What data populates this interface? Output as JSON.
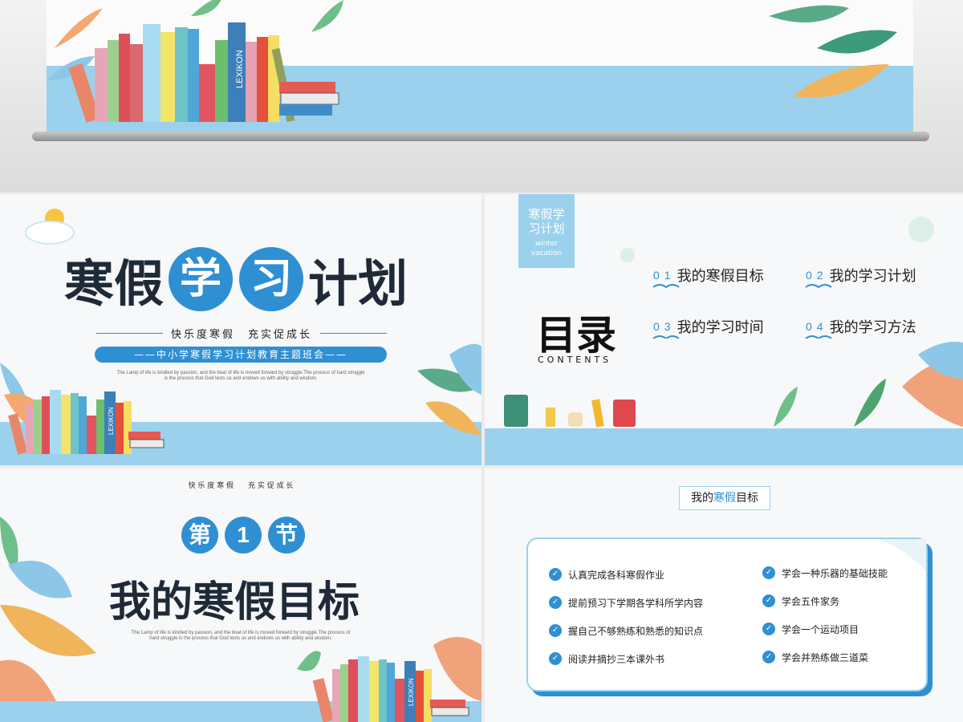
{
  "top": {
    "book_spine": "LEXIKON"
  },
  "slide1": {
    "title_a": "寒假",
    "title_b": "学",
    "title_c": "习",
    "title_d": "计划",
    "slogan": "快乐度寒假　充实促成长",
    "banner": "——中小学寒假学习计划教育主题班会——",
    "english_1": "The Lamp of life is kindled by passion, and the boat of life is moved forward by struggle.The process of hard struggle",
    "english_2": "is the process that God tests us and endows us with ability and wisdom.",
    "book_spine": "LEXIKON"
  },
  "slide2": {
    "tag_line1": "寒假学",
    "tag_line2": "习计划",
    "tag_en1": "winter",
    "tag_en2": "vacation",
    "heading": "目录",
    "heading_en": "CONTENTS",
    "items": [
      {
        "num": "01",
        "text": "我的寒假目标"
      },
      {
        "num": "02",
        "text": "我的学习计划"
      },
      {
        "num": "03",
        "text": "我的学习时间"
      },
      {
        "num": "04",
        "text": "我的学习方法"
      }
    ]
  },
  "slide3": {
    "slogan": "快 乐 度 寒 假　　充 实 促 成 长",
    "section_a": "第",
    "section_b": "1",
    "section_c": "节",
    "title": "我的寒假目标",
    "english_1": "The Lamp of life is kindled by passion, and the boat of life is moved forward by struggle.The process of",
    "english_2": "hard struggle is the process that God tests us and endows us with ability and wisdom.",
    "book_spine": "LEXIKON"
  },
  "slide4": {
    "header_a": "我的",
    "header_b": "寒假",
    "header_c": "目标",
    "left_goals": [
      "认真完成各科寒假作业",
      "提前预习下学期各学科所学内容",
      "握自己不够熟练和熟悉的知识点",
      "阅读并摘抄三本课外书"
    ],
    "right_goals": [
      "学会一种乐器的基础技能",
      "学会五件家务",
      "学会一个运动项目",
      "学会并熟练做三道菜"
    ]
  }
}
